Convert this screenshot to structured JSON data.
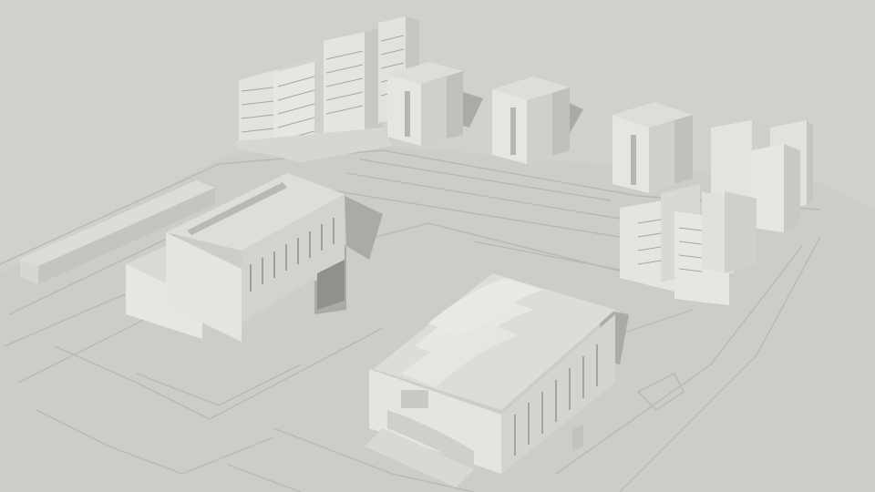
{
  "scene": {
    "subject": "massing-model",
    "colors": {
      "background": "#cfd1cc",
      "ground": "#cbcdc8",
      "road_line": "#b9bbb6",
      "face_light": "#e4e5e1",
      "face_mid": "#d3d4d0",
      "face_dark": "#b2b3ae",
      "roof": "#dddeda",
      "shadow": "#a6a8a3",
      "window": "#8f918c"
    }
  }
}
